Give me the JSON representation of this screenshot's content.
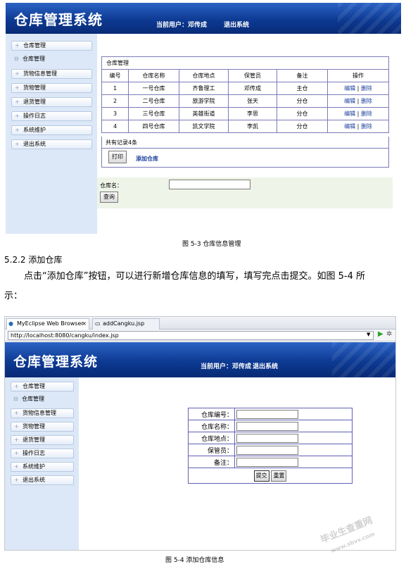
{
  "top_screen": {
    "logo": "仓库管理系统",
    "current_user": "当前用户：邓传成",
    "logout": "退出系统",
    "sidebar": [
      "仓库管理",
      "仓库管理",
      "货物信息管理",
      "货物管理",
      "退货管理",
      "操作日志",
      "系统维护",
      "退出系统"
    ],
    "panel_title": "仓库管理",
    "table": {
      "headers": [
        "编号",
        "仓库名称",
        "仓库地点",
        "保管员",
        "备注",
        "操作"
      ],
      "rows": [
        [
          "1",
          "一号仓库",
          "齐鲁理工",
          "邓传成",
          "主仓"
        ],
        [
          "2",
          "二号仓库",
          "旅游学院",
          "张天",
          "分仓"
        ],
        [
          "3",
          "三号仓库",
          "英雄街道",
          "李思",
          "分仓"
        ],
        [
          "4",
          "四号仓库",
          "凯文学院",
          "李凯",
          "分仓"
        ]
      ],
      "edit_label": "编辑",
      "separator": "|",
      "delete_label": "删除",
      "total": "共有记录4条"
    },
    "print_button": "打印",
    "add_link": "添加仓库",
    "search_label": "仓库名：",
    "search_button": "查询"
  },
  "caption1": "图 5-3 仓库信息管理",
  "heading": "5.2.2  添加仓库",
  "paragraph_line1": "点击“添加仓库”按钮，可以进行新增仓库信息的填写，填写完点击提交。如图 5-4 所",
  "paragraph_line2": "示：",
  "bottom_screen": {
    "tab1": "MyEclipse Web Browser",
    "tab2": "addCangku.jsp",
    "url": "http://localhost:8080/cangku/index.jsp",
    "logo": "仓库管理系统",
    "current_user": "当前用户：邓传成",
    "logout": "退出系统",
    "sidebar": [
      "仓库管理",
      "仓库管理",
      "货物信息管理",
      "货物管理",
      "退货管理",
      "操作日志",
      "系统维护",
      "退出系统"
    ],
    "form_labels": [
      "仓库编号：",
      "仓库名称：",
      "仓库地点：",
      "保管员：",
      "备注："
    ],
    "submit_button": "提交",
    "reset_button": "重置"
  },
  "caption2": "图 5-4 添加仓库信息",
  "watermark": "毕业生查重网",
  "watermark_url": "www.sbvv.com"
}
